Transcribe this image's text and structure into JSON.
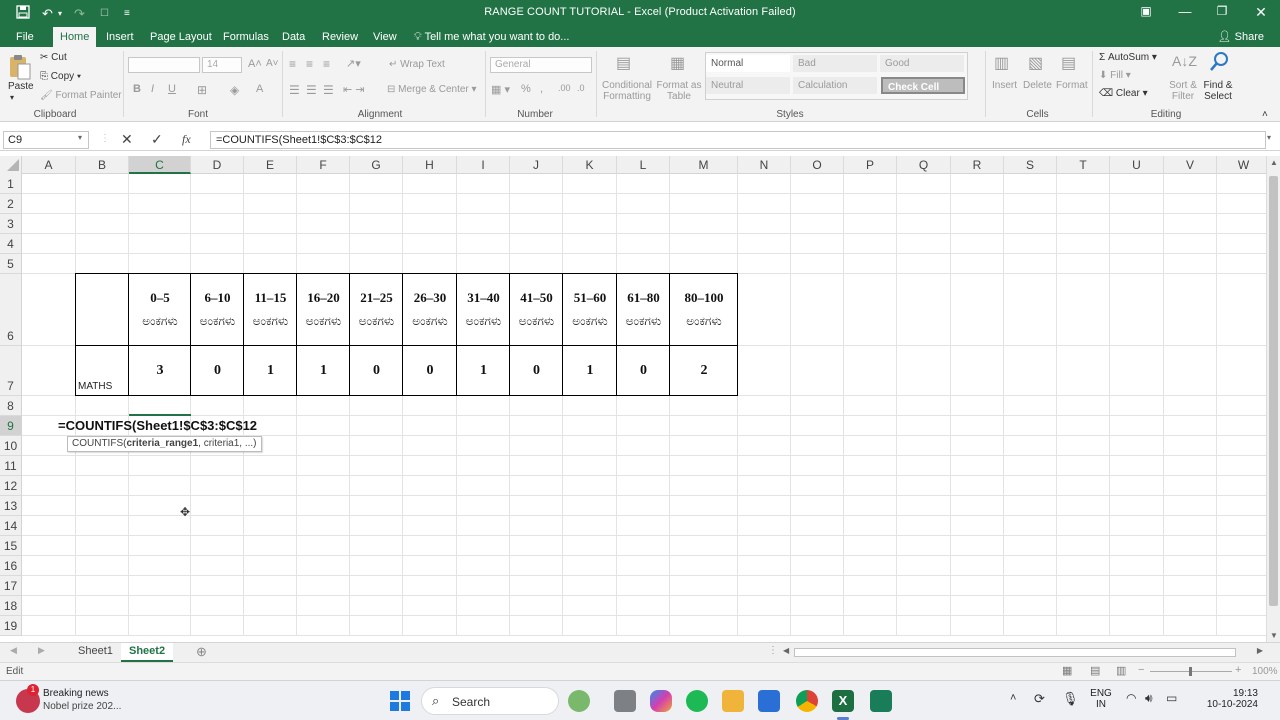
{
  "window": {
    "title": "RANGE COUNT TUTORIAL - Excel (Product Activation Failed)"
  },
  "ribbon_tabs": [
    "File",
    "Home",
    "Insert",
    "Page Layout",
    "Formulas",
    "Data",
    "Review",
    "View"
  ],
  "active_tab": "Home",
  "tell_me": "Tell me what you want to do...",
  "share_label": "Share",
  "clipboard": {
    "paste": "Paste",
    "cut": "Cut",
    "copy": "Copy",
    "format_painter": "Format Painter",
    "label": "Clipboard"
  },
  "font": {
    "size": "14",
    "label": "Font",
    "bold": "B",
    "italic": "I",
    "underline": "U"
  },
  "alignment": {
    "wrap": "Wrap Text",
    "merge": "Merge & Center",
    "label": "Alignment"
  },
  "number": {
    "format": "General",
    "label": "Number"
  },
  "styles": {
    "conditional": [
      "Conditional",
      "Formatting"
    ],
    "format_as_table": [
      "Format as",
      "Table"
    ],
    "cells": [
      "Normal",
      "Bad",
      "Good",
      "Neutral",
      "Calculation",
      "Check Cell"
    ],
    "label": "Styles"
  },
  "cells_group": {
    "insert": "Insert",
    "delete": "Delete",
    "format": "Format",
    "label": "Cells"
  },
  "editing": {
    "autosum": "AutoSum",
    "fill": "Fill",
    "clear": "Clear",
    "sort": [
      "Sort &",
      "Filter"
    ],
    "find": [
      "Find &",
      "Select"
    ],
    "label": "Editing"
  },
  "formula_bar": {
    "name_box": "C9",
    "formula": "=COUNTIFS(Sheet1!$C$3:$C$12"
  },
  "columns": [
    "A",
    "B",
    "C",
    "D",
    "E",
    "F",
    "G",
    "H",
    "I",
    "J",
    "K",
    "L",
    "M",
    "N",
    "O",
    "P",
    "Q",
    "R",
    "S",
    "T",
    "U",
    "V",
    "W"
  ],
  "rows": [
    "1",
    "2",
    "3",
    "4",
    "5",
    "6",
    "7",
    "8",
    "9",
    "10",
    "11",
    "12",
    "13",
    "14",
    "15",
    "16",
    "17",
    "18",
    "19"
  ],
  "table": {
    "ranges": [
      "0–5",
      "6–10",
      "11–15",
      "16–20",
      "21–25",
      "26–30",
      "31–40",
      "41–50",
      "51–60",
      "61–80",
      "80–100"
    ],
    "unit": "ಅಂಕಗಳು",
    "row_label": "MATHS",
    "counts": [
      "3",
      "0",
      "1",
      "1",
      "0",
      "0",
      "1",
      "0",
      "1",
      "0",
      "2"
    ]
  },
  "editing_cell": "=COUNTIFS(Sheet1!$C$3:$C$12",
  "tooltip": {
    "fn": "COUNTIFS(",
    "arg": "criteria_range1",
    "rest": ", criteria1, ...)"
  },
  "sheets": [
    "Sheet1",
    "Sheet2"
  ],
  "active_sheet": "Sheet2",
  "status": {
    "mode": "Edit",
    "zoom": "100%"
  },
  "taskbar": {
    "news_title": "Breaking news",
    "news_sub": "Nobel prize 202...",
    "search": "Search",
    "lang": "ENG",
    "region": "IN",
    "time": "19:13",
    "date": "10-10-2024"
  },
  "colors": {
    "excel_green": "#217346",
    "taskbar": "#eef0f4"
  }
}
